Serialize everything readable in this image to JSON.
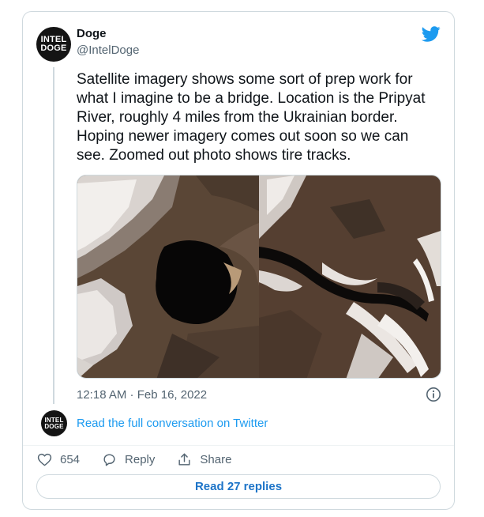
{
  "author": {
    "name": "Doge",
    "handle": "@IntelDoge",
    "avatar_line1": "INTEL",
    "avatar_line2": "DOGE"
  },
  "tweet": {
    "text": "Satellite imagery shows some sort of prep work for\nwhat I imagine to be a bridge. Location is the Pripyat\nRiver, roughly 4 miles from the Ukrainian border.\nHoping newer imagery comes out soon so we can\nsee. Zoomed out photo shows tire tracks.",
    "timestamp": "12:18 AM · Feb 16, 2022",
    "media": [
      {
        "icon": "satellite-photo-closeup"
      },
      {
        "icon": "satellite-photo-zoomed-out"
      }
    ]
  },
  "conversation": {
    "link_text": "Read the full conversation on Twitter"
  },
  "actions": {
    "like_count": "654",
    "reply_label": "Reply",
    "share_label": "Share"
  },
  "replies": {
    "button_label": "Read 27 replies"
  },
  "icons": {
    "brand": "twitter-bird-icon",
    "info": "info-icon",
    "like": "heart-icon",
    "reply": "speech-bubble-icon",
    "share": "share-icon"
  },
  "colors": {
    "brand_blue": "#1d9bf0",
    "link_blue": "#1d9bf0",
    "button_text": "#1d74c8",
    "secondary_text": "#536471",
    "border": "#cfd9de"
  }
}
